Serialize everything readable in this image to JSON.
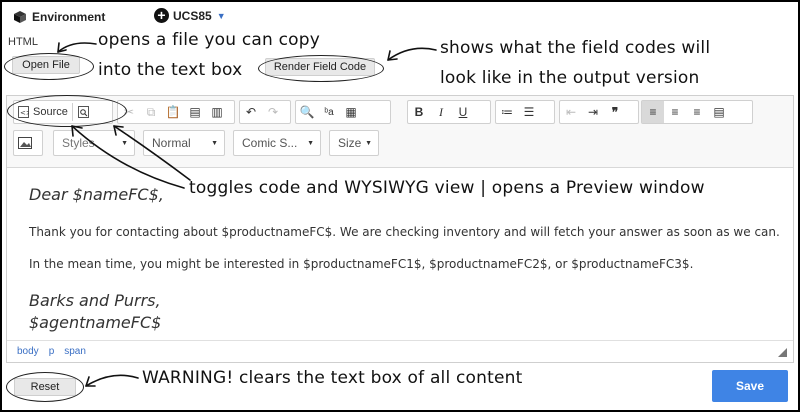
{
  "header": {
    "environment_label": "Environment",
    "tenant_label": "UCS85"
  },
  "section_label": "HTML",
  "buttons": {
    "open_file": "Open File",
    "render_field_code": "Render Field Code",
    "reset": "Reset",
    "save": "Save"
  },
  "toolbar": {
    "source_label": "Source",
    "styles_label": "Styles",
    "format_label": "Normal",
    "font_label": "Comic S...",
    "size_label": "Size"
  },
  "content": {
    "greeting": "Dear $nameFC$,",
    "line1": "Thank you for contacting about $productnameFC$. We are checking inventory and will fetch your answer as soon as we can.",
    "line2": "In the mean time, you might be interested in $productnameFC1$, $productnameFC2$, or $productnameFC3$.",
    "signoff1": "Barks and Purrs,",
    "signoff2": "$agentnameFC$"
  },
  "path": [
    "body",
    "p",
    "span"
  ],
  "annotations": {
    "open_file_1": "opens a file you can copy",
    "open_file_2": "into the text box",
    "render_1": "shows what the field codes will",
    "render_2": "look like in the output version",
    "toggle": "toggles code and WYSIWYG view | opens a Preview window",
    "reset": "WARNING! clears the text box of all content"
  },
  "colors": {
    "accent": "#3f84e5",
    "link": "#3a6fc4"
  }
}
